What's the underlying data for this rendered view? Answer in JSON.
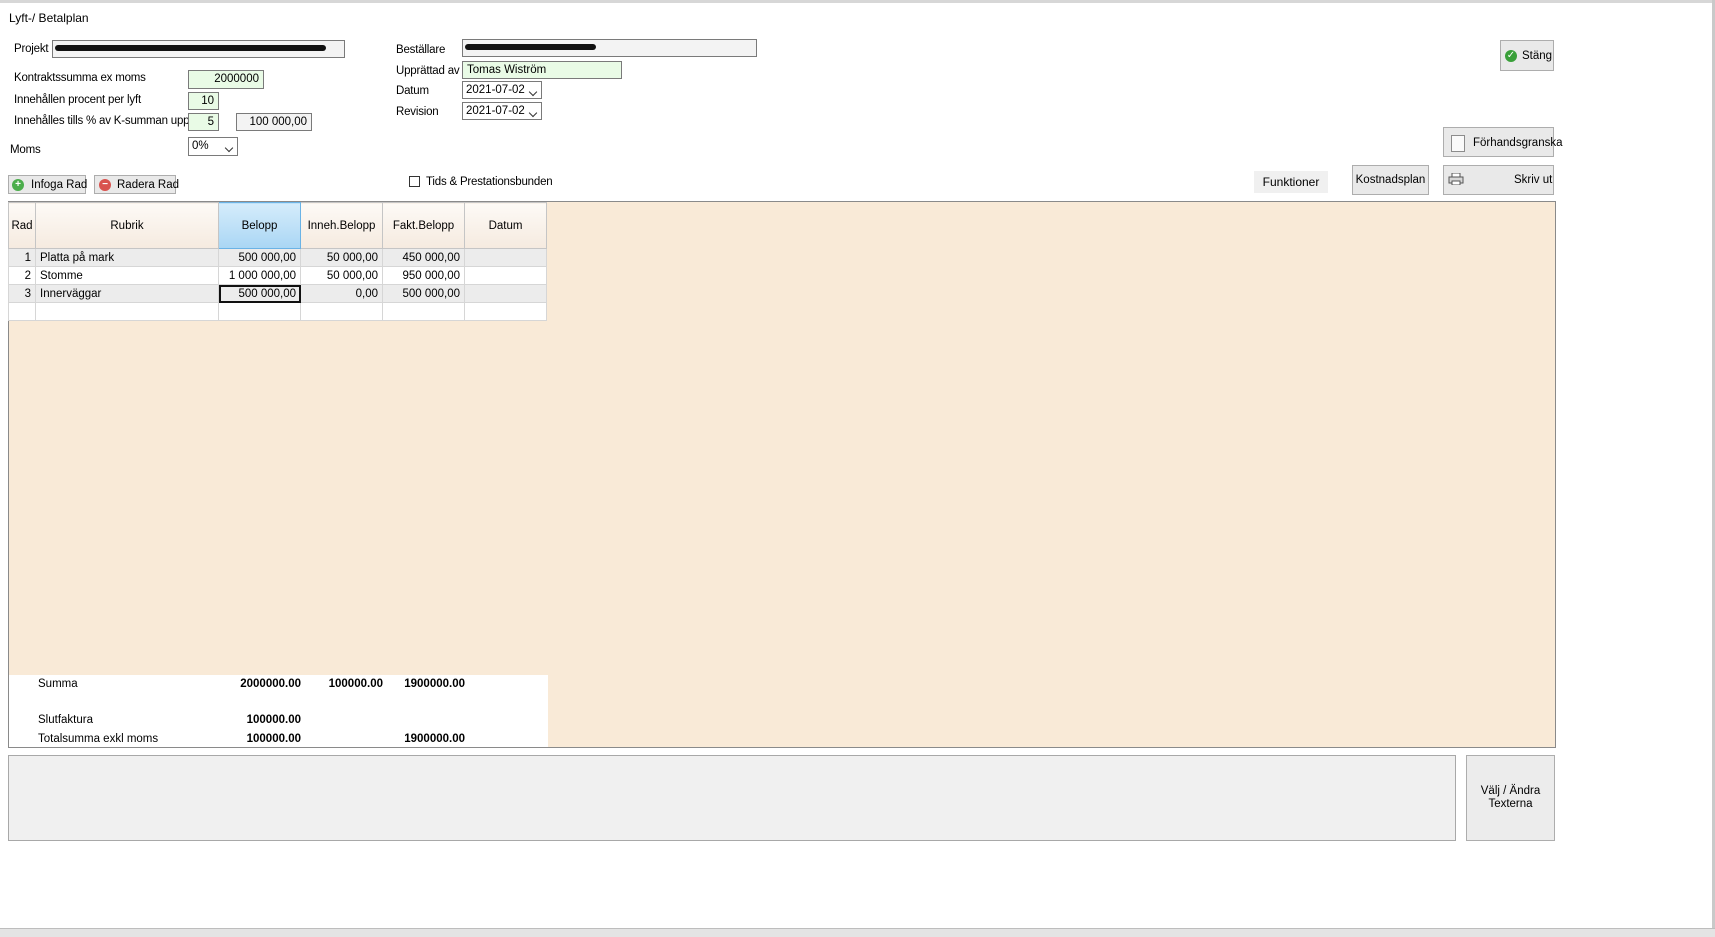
{
  "window": {
    "title": "Lyft-/ Betalplan"
  },
  "form": {
    "projekt_label": "Projekt",
    "kontrakt_label": "Kontraktssumma ex moms",
    "kontrakt_value": "2000000",
    "innehallen_label": "Innehållen procent per lyft",
    "innehallen_value": "10",
    "innehalles_label": "Innehålles tills % av K-summan uppnätts",
    "innehalles_pct": "5",
    "innehalles_amount": "100 000,00",
    "moms_label": "Moms",
    "moms_value": "0%",
    "bestallare_label": "Beställare",
    "upprattad_label": "Upprättad av",
    "upprattad_value": "Tomas Wiström",
    "datum_label": "Datum",
    "datum_value": "2021-07-02",
    "revision_label": "Revision",
    "revision_value": "2021-07-02",
    "tids_label": "Tids & Prestationsbunden"
  },
  "buttons": {
    "stang": "Stäng",
    "forhandsgranska": "Förhandsgranska",
    "skriv_ut": "Skriv ut",
    "funktioner": "Funktioner",
    "kostnadsplan": "Kostnadsplan",
    "infoga": "Infoga Rad",
    "radera": "Radera Rad",
    "valj_line1": "Välj / Ändra",
    "valj_line2": "Texterna"
  },
  "table": {
    "columns": [
      "Rad",
      "Rubrik",
      "Belopp",
      "Inneh.Belopp",
      "Fakt.Belopp",
      "Datum"
    ],
    "rows": [
      {
        "rad": "1",
        "rubrik": "Platta på mark",
        "belopp": "500 000,00",
        "inneh": "50 000,00",
        "fakt": "450 000,00",
        "datum": ""
      },
      {
        "rad": "2",
        "rubrik": "Stomme",
        "belopp": "1 000 000,00",
        "inneh": "50 000,00",
        "fakt": "950 000,00",
        "datum": ""
      },
      {
        "rad": "3",
        "rubrik": "Innerväggar",
        "belopp": "500 000,00",
        "inneh": "0,00",
        "fakt": "500 000,00",
        "datum": ""
      }
    ]
  },
  "summary": {
    "summa_label": "Summa",
    "summa_belopp": "2000000.00",
    "summa_inneh": "100000.00",
    "summa_fakt": "1900000.00",
    "slutfaktura_label": "Slutfaktura",
    "slutfaktura_belopp": "100000.00",
    "total_label": "Totalsumma exkl moms",
    "total_belopp": "100000.00",
    "total_fakt": "1900000.00"
  },
  "colors": {
    "grid_background": "#f9ead7",
    "input_green": "#e9fbe6",
    "selected_header": "#a9d6f4"
  }
}
